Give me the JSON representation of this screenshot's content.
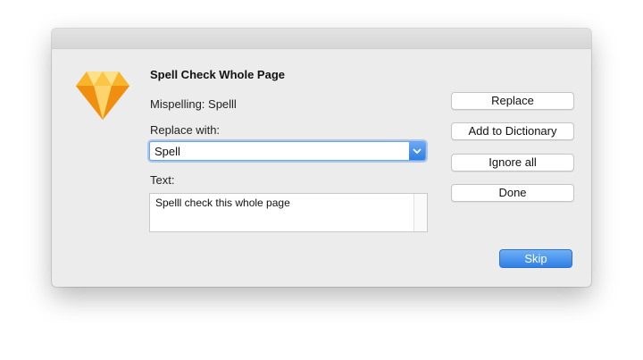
{
  "dialog": {
    "title": "Spell Check Whole Page",
    "mispelling_text": "Mispelling: Spelll",
    "replace_with_label": "Replace with:",
    "replace_with_value": "Spell",
    "text_label": "Text:",
    "text_content": "Spelll check this whole page"
  },
  "buttons": {
    "replace": "Replace",
    "add_to_dictionary": "Add to Dictionary",
    "ignore_all": "Ignore all",
    "done": "Done",
    "skip": "Skip"
  },
  "icons": {
    "app": "sketch-diamond-icon",
    "dropdown": "chevron-down-icon"
  },
  "colors": {
    "accent": "#2f7fe4",
    "icon_gold": "#f7b52c"
  }
}
